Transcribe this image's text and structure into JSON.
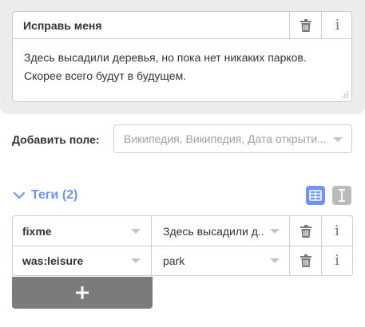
{
  "field": {
    "label": "Исправь меня",
    "value_line1": "Здесь высадили деревья, но пока нет никаких парков.",
    "value_line2": "Скорее всего будут в будущем."
  },
  "add_field": {
    "label": "Добавить поле:",
    "placeholder": "Википедия, Википедия, Дата открыти..."
  },
  "tags": {
    "title": "Теги (2)",
    "rows": [
      {
        "key": "fixme",
        "value": "Здесь высадили д..."
      },
      {
        "key": "was:leisure",
        "value": "park"
      }
    ]
  },
  "icons": {
    "delete": "trash-icon",
    "info": "info-icon",
    "expand": "chevron-down-icon",
    "list_view": "list-view-icon",
    "text_view": "text-view-icon",
    "add": "plus-icon"
  },
  "colors": {
    "accent": "#7092ff",
    "add_button": "#7b7b7b",
    "panel_bg": "#ececec"
  }
}
